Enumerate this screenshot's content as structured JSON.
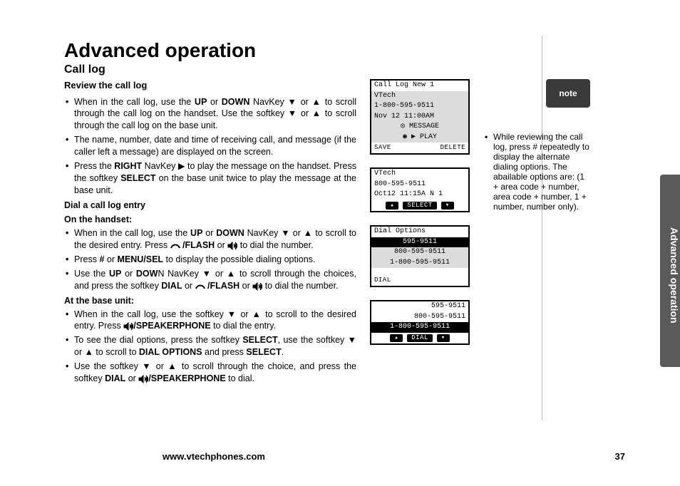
{
  "sideTab": "Advanced operation",
  "heading": "Advanced operation",
  "subheading": "Call log",
  "section1_title": "Review the call log",
  "section1": {
    "b1a": "When in the call log, use the ",
    "b1b": "UP",
    "b1c": " or ",
    "b1d": "DOWN",
    "b1e": " NavKey ▼ or ▲ to scroll through the call log on the handset. Use the softkey ▼ or ▲ to scroll through the call log on the base unit.",
    "b2": "The name, number, date and time of receiving call, and message (if the caller left a message) are displayed on the screen.",
    "b3a": "Press the ",
    "b3b": "RIGHT",
    "b3c": " NavKey ▶ to play the message on the handset. Press the softkey ",
    "b3d": "SELECT",
    "b3e": " on the base unit twice to play the message at the base unit."
  },
  "section2_title": "Dial a call log entry",
  "onhandset": "On the handset:",
  "hs": {
    "b1a": "When in the call log, use the ",
    "b1b": "UP",
    "b1c": " or ",
    "b1d": "DOWN",
    "b1e": " NavKey ▼ or ▲ to scroll to the desired entry. Press ",
    "b1f": "/FLASH",
    "b1g": " or ",
    "b1h": " to dial the number.",
    "b2a": "Press ",
    "b2b": "#",
    "b2c": " or ",
    "b2d": "MENU/SEL",
    "b2e": " to display the possible dialing options.",
    "b3a": "Use the ",
    "b3b": "UP",
    "b3c": " or ",
    "b3d": "DOW",
    "b3e": "N NavKey  ▼ or ▲  to scroll through the choices, and press the softkey ",
    "b3f": "DIAL",
    "b3g": " or ",
    "b3h": "/FLASH",
    "b3i": " or ",
    "b3j": " to dial the number."
  },
  "onbase": "At the base unit:",
  "bs": {
    "b1a": "When in the call log, use the softkey ▼ or ▲ to scroll to the desired entry. Press ",
    "b1b": "/SPEAKERPHONE",
    "b1c": " to dial the entry.",
    "b2a": "To see the dial options, press the softkey ",
    "b2b": "SELECT",
    "b2c": ", use the softkey ▼ or ▲ to scroll to ",
    "b2d": "DIAL OPTIONS",
    "b2e": " and press ",
    "b2f": "SELECT",
    "b2g": ".",
    "b3a": "Use the softkey ▼ or ▲ to scroll through the choice, and press the softkey ",
    "b3b": "DIAL",
    "b3c": " or ",
    "b3d": "/SPEAKERPHONE",
    "b3e": " to dial."
  },
  "lcd1": {
    "r1": "Call Log  New     1",
    "r2": "VTech",
    "r3": "1-800-595-9511",
    "r4": "Nov  12  11:00AM",
    "r5": "◎ MESSAGE",
    "r6": "◉ ▶ PLAY",
    "left": "SAVE",
    "right": "DELETE"
  },
  "lcd2": {
    "r1": "VTech",
    "r2": "800-595-9511",
    "r3": "Oct12 11:15A  N 1",
    "mid": "SELECT"
  },
  "lcd3": {
    "r1": "Dial Options",
    "r2": "595-9511",
    "r3": "800-595-9511",
    "r4": "1-800-595-9511",
    "left": "DIAL"
  },
  "lcd4": {
    "r1": "595-9511",
    "r2": "800-595-9511",
    "r3": "1-800-595-9511",
    "mid": "DIAL"
  },
  "note_badge": "note",
  "note_text": "While reviewing the call log, press # repeatedly to display the alternate dialing options. The abailable options are:  (1 + area code + number, area code + number, 1 + number, number only).",
  "footer_url": "www.vtechphones.com",
  "page_num": "37"
}
